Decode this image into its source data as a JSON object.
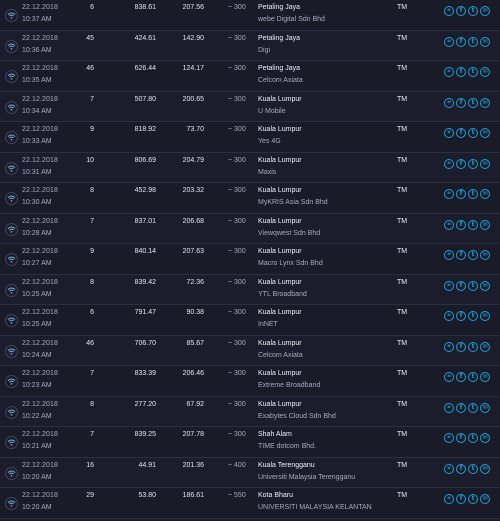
{
  "colors": {
    "accent": "#1f9fd6",
    "background": "#1a1b29"
  },
  "icons": {
    "connection": "wifi-icon",
    "actions": [
      "link-icon",
      "facebook-icon",
      "twitter-icon",
      "email-icon"
    ]
  },
  "action_glyphs": [
    "⚭",
    "f",
    "t",
    "✉"
  ],
  "rows": [
    {
      "date": "22.12.2018",
      "time": "10:37 AM",
      "ping": "6",
      "download": "838.61",
      "upload": "207.56",
      "distance": "~ 300",
      "location": "Petaling Jaya",
      "isp": "webe Digital Sdn Bhd",
      "provider": "TM"
    },
    {
      "date": "22.12.2018",
      "time": "10:36 AM",
      "ping": "45",
      "download": "424.61",
      "upload": "142.90",
      "distance": "~ 300",
      "location": "Petaling Jaya",
      "isp": "Digi",
      "provider": "TM"
    },
    {
      "date": "22.12.2018",
      "time": "10:35 AM",
      "ping": "46",
      "download": "626.44",
      "upload": "124.17",
      "distance": "~ 300",
      "location": "Petaling Jaya",
      "isp": "Celcom Axiata",
      "provider": "TM"
    },
    {
      "date": "22.12.2018",
      "time": "10:34 AM",
      "ping": "7",
      "download": "507.80",
      "upload": "200.65",
      "distance": "~ 300",
      "location": "Kuala Lumpur",
      "isp": "U Mobile",
      "provider": "TM"
    },
    {
      "date": "22.12.2018",
      "time": "10:33 AM",
      "ping": "9",
      "download": "818.92",
      "upload": "73.70",
      "distance": "~ 300",
      "location": "Kuala Lumpur",
      "isp": "Yes 4G",
      "provider": "TM"
    },
    {
      "date": "22.12.2018",
      "time": "10:31 AM",
      "ping": "10",
      "download": "806.69",
      "upload": "204.79",
      "distance": "~ 300",
      "location": "Kuala Lumpur",
      "isp": "Maxis",
      "provider": "TM"
    },
    {
      "date": "22.12.2018",
      "time": "10:30 AM",
      "ping": "8",
      "download": "452.98",
      "upload": "203.32",
      "distance": "~ 300",
      "location": "Kuala Lumpur",
      "isp": "MyKRIS Asia Sdn Bhd",
      "provider": "TM"
    },
    {
      "date": "22.12.2018",
      "time": "10:28 AM",
      "ping": "7",
      "download": "837.01",
      "upload": "206.68",
      "distance": "~ 300",
      "location": "Kuala Lumpur",
      "isp": "Viewqwest Sdn Bhd",
      "provider": "TM"
    },
    {
      "date": "22.12.2018",
      "time": "10:27 AM",
      "ping": "9",
      "download": "840.14",
      "upload": "207.63",
      "distance": "~ 300",
      "location": "Kuala Lumpur",
      "isp": "Macro Lynx Sdn Bhd",
      "provider": "TM"
    },
    {
      "date": "22.12.2018",
      "time": "10:25 AM",
      "ping": "8",
      "download": "839.42",
      "upload": "72.36",
      "distance": "~ 300",
      "location": "Kuala Lumpur",
      "isp": "YTL Broadband",
      "provider": "TM"
    },
    {
      "date": "22.12.2018",
      "time": "10:25 AM",
      "ping": "6",
      "download": "791.47",
      "upload": "90.38",
      "distance": "~ 300",
      "location": "Kuala Lumpur",
      "isp": "InNET",
      "provider": "TM"
    },
    {
      "date": "22.12.2018",
      "time": "10:24 AM",
      "ping": "46",
      "download": "706.70",
      "upload": "85.67",
      "distance": "~ 300",
      "location": "Kuala Lumpur",
      "isp": "Celcom Axiata",
      "provider": "TM"
    },
    {
      "date": "22.12.2018",
      "time": "10:23 AM",
      "ping": "7",
      "download": "833.39",
      "upload": "206.46",
      "distance": "~ 300",
      "location": "Kuala Lumpur",
      "isp": "Extreme Broadband",
      "provider": "TM"
    },
    {
      "date": "22.12.2018",
      "time": "10:22 AM",
      "ping": "8",
      "download": "277.20",
      "upload": "67.92",
      "distance": "~ 300",
      "location": "Kuala Lumpur",
      "isp": "Exabytes Cloud Sdn Bhd",
      "provider": "TM"
    },
    {
      "date": "22.12.2018",
      "time": "10:21 AM",
      "ping": "7",
      "download": "839.25",
      "upload": "207.78",
      "distance": "~ 300",
      "location": "Shah Alam",
      "isp": "TIME dotcom Bhd.",
      "provider": "TM"
    },
    {
      "date": "22.12.2018",
      "time": "10:20 AM",
      "ping": "16",
      "download": "44.91",
      "upload": "201.36",
      "distance": "~ 400",
      "location": "Kuala Terengganu",
      "isp": "Universiti Malaysia Terengganu",
      "provider": "TM"
    },
    {
      "date": "22.12.2018",
      "time": "10:20 AM",
      "ping": "29",
      "download": "53.80",
      "upload": "186.61",
      "distance": "~ 550",
      "location": "Kota Bharu",
      "isp": "UNIVERSITI MALAYSIA KELANTAN",
      "provider": "TM"
    }
  ]
}
